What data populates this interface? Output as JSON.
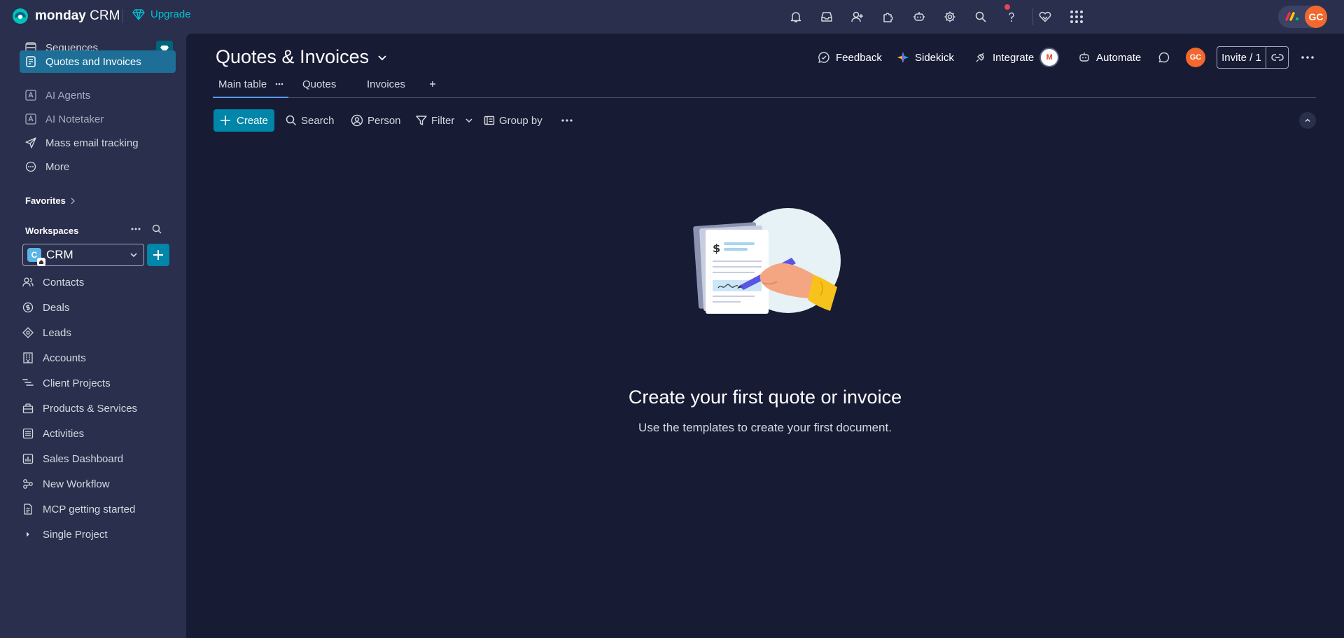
{
  "topbar": {
    "brand_bold": "monday",
    "brand_light": "CRM",
    "upgrade_label": "Upgrade",
    "avatar_initials": "GC",
    "icons": [
      "bell-icon",
      "inbox-icon",
      "invite-members-icon",
      "apps-icon",
      "bot-icon",
      "settings-icon",
      "search-icon",
      "help-icon",
      "heart-icon",
      "app-switcher-icon"
    ]
  },
  "sidebar": {
    "items": [
      {
        "label": "Sequences",
        "icon": "sequences-icon"
      },
      {
        "label": "Quotes and Invoices",
        "icon": "quotes-icon",
        "active": true
      },
      {
        "label": "AI Agents",
        "icon": "ai-agents-icon"
      },
      {
        "label": "AI Notetaker",
        "icon": "ai-notetaker-icon"
      },
      {
        "label": "Mass email tracking",
        "icon": "send-icon"
      },
      {
        "label": "More",
        "icon": "more-circle-icon"
      }
    ],
    "favorites_label": "Favorites",
    "workspaces_label": "Workspaces",
    "workspace": {
      "initial": "C",
      "name": "CRM"
    },
    "boards": [
      {
        "label": "Contacts",
        "icon": "contacts-icon"
      },
      {
        "label": "Deals",
        "icon": "deals-icon"
      },
      {
        "label": "Leads",
        "icon": "leads-icon"
      },
      {
        "label": "Accounts",
        "icon": "accounts-icon"
      },
      {
        "label": "Client Projects",
        "icon": "projects-icon"
      },
      {
        "label": "Products & Services",
        "icon": "products-icon"
      },
      {
        "label": "Activities",
        "icon": "activities-icon"
      },
      {
        "label": "Sales Dashboard",
        "icon": "dashboard-icon"
      },
      {
        "label": "New Workflow",
        "icon": "workflow-icon"
      },
      {
        "label": "MCP getting started",
        "icon": "doc-icon"
      },
      {
        "label": "Single Project",
        "icon": "caret-right-icon"
      }
    ]
  },
  "board": {
    "title": "Quotes & Invoices",
    "actions": {
      "feedback": "Feedback",
      "sidekick": "Sidekick",
      "integrate": "Integrate",
      "automate": "Automate",
      "avatar_initials": "GC",
      "invite": "Invite / 1"
    },
    "tabs": [
      {
        "label": "Main table"
      },
      {
        "label": "Quotes"
      },
      {
        "label": "Invoices"
      }
    ],
    "toolbar": {
      "create": "Create",
      "search": "Search",
      "person": "Person",
      "filter": "Filter",
      "group_by": "Group by"
    },
    "empty_state": {
      "title": "Create your first quote or invoice",
      "subtitle": "Use the templates to create your first document."
    }
  },
  "colors": {
    "accent": "#0086a8",
    "active_item": "#1d6f97",
    "brand_orange": "#f2682d",
    "upgrade": "#00c2d6"
  }
}
